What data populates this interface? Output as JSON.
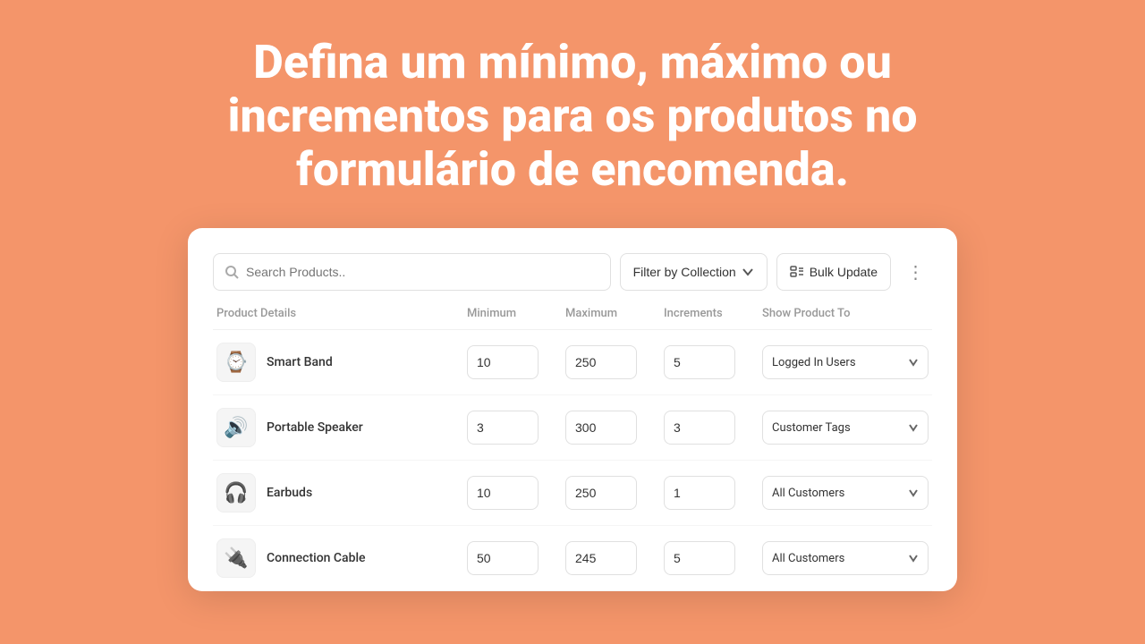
{
  "hero": {
    "text": "Defina um mínimo, máximo ou incrementos para os produtos no formulário de encomenda."
  },
  "toolbar": {
    "search_placeholder": "Search Products..",
    "filter_label": "Filter by Collection",
    "bulk_label": "Bulk Update"
  },
  "table": {
    "headers": {
      "product": "Product Details",
      "minimum": "Minimum",
      "maximum": "Maximum",
      "increments": "Increments",
      "show_to": "Show Product To"
    },
    "rows": [
      {
        "id": "smart-band",
        "icon": "⌚",
        "name": "Smart Band",
        "min": "10",
        "max": "250",
        "inc": "5",
        "show_to": "Logged In Users"
      },
      {
        "id": "portable-speaker",
        "icon": "🔊",
        "name": "Portable Speaker",
        "min": "3",
        "max": "300",
        "inc": "3",
        "show_to": "Customer Tags"
      },
      {
        "id": "earbuds",
        "icon": "🎧",
        "name": "Earbuds",
        "min": "10",
        "max": "250",
        "inc": "1",
        "show_to": "All Customers"
      },
      {
        "id": "connection-cable",
        "icon": "🔌",
        "name": "Connection Cable",
        "min": "50",
        "max": "245",
        "inc": "5",
        "show_to": "All Customers"
      }
    ]
  }
}
